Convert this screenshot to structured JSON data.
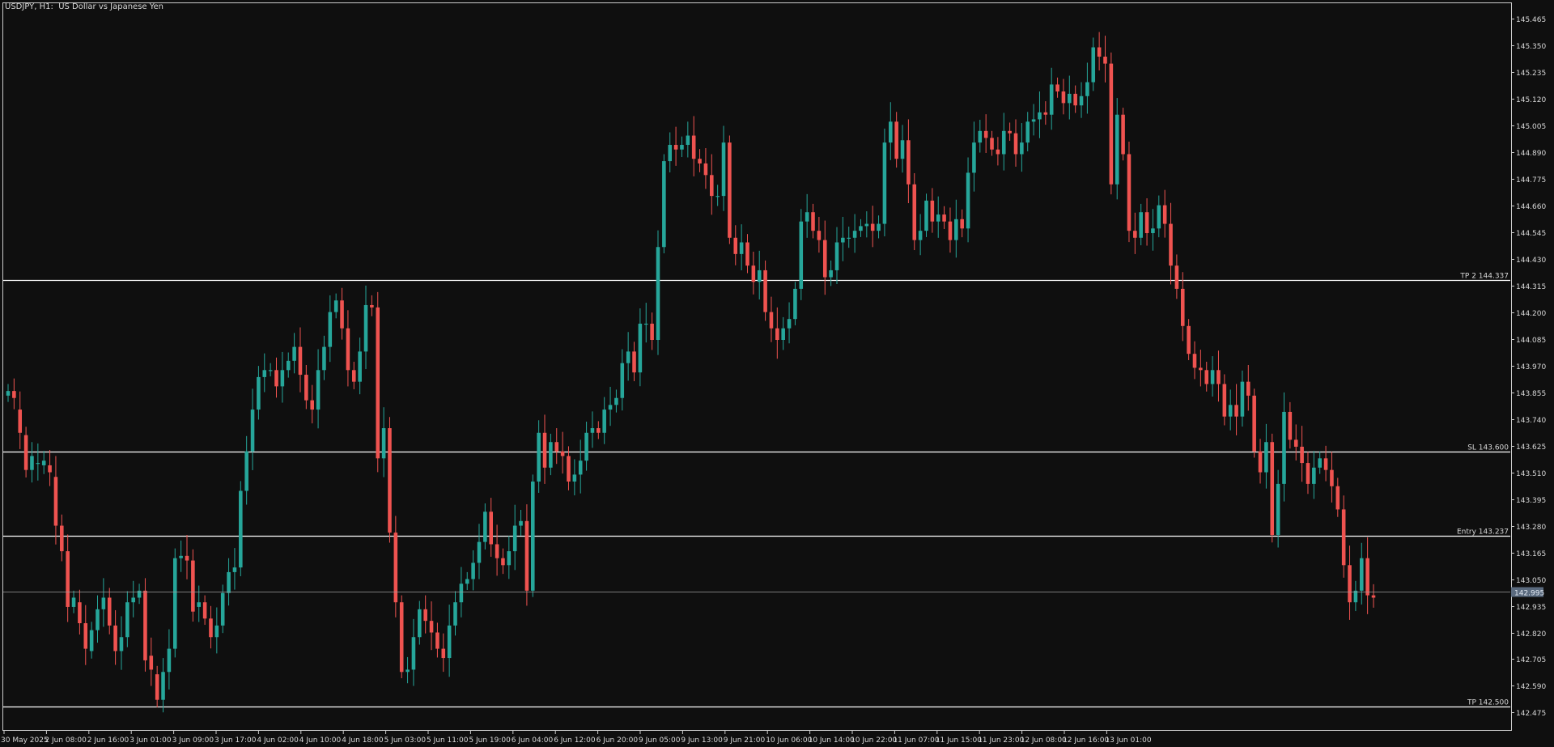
{
  "chart_title": "USDJPY, H1:  US Dollar vs Japanese Yen",
  "colors": {
    "background": "#0f0f0f",
    "frame": "#cccccc",
    "up": "#26a69a",
    "down": "#ef5350",
    "level_line": "#ffffff",
    "bid_line": "#9e9e9e",
    "bid_label_bg": "#5a6a7e",
    "text": "#d8d8d8"
  },
  "chart_data": {
    "type": "candlestick",
    "symbol": "USDJPY",
    "timeframe": "H1",
    "title": "USDJPY, H1:  US Dollar vs Japanese Yen",
    "ylim": [
      142.4,
      145.53
    ],
    "y_tick_labels": [
      "145.465",
      "145.350",
      "145.235",
      "145.120",
      "145.005",
      "144.890",
      "144.775",
      "144.660",
      "144.545",
      "144.430",
      "144.315",
      "144.200",
      "144.085",
      "143.970",
      "143.855",
      "143.740",
      "143.625",
      "143.510",
      "143.395",
      "143.280",
      "143.165",
      "143.050",
      "142.935",
      "142.820",
      "142.705",
      "142.590",
      "142.475"
    ],
    "x_tick_labels": [
      "30 May 2025",
      "2 Jun 08:00",
      "2 Jun 16:00",
      "3 Jun 01:00",
      "3 Jun 09:00",
      "3 Jun 17:00",
      "4 Jun 02:00",
      "4 Jun 10:00",
      "4 Jun 18:00",
      "5 Jun 03:00",
      "5 Jun 11:00",
      "5 Jun 19:00",
      "6 Jun 04:00",
      "6 Jun 12:00",
      "6 Jun 20:00",
      "9 Jun 05:00",
      "9 Jun 13:00",
      "9 Jun 21:00",
      "10 Jun 06:00",
      "10 Jun 14:00",
      "10 Jun 22:00",
      "11 Jun 07:00",
      "11 Jun 15:00",
      "11 Jun 23:00",
      "12 Jun 08:00",
      "12 Jun 16:00",
      "13 Jun 01:00"
    ],
    "levels": [
      {
        "label": "TP 2 144.337",
        "value": 144.337
      },
      {
        "label": "SL 143.600",
        "value": 143.6
      },
      {
        "label": "Entry 143.237",
        "value": 143.237
      },
      {
        "label": "TP 142.500",
        "value": 142.5
      }
    ],
    "bid": {
      "label": "142.995",
      "value": 142.995
    },
    "close": [
      143.86,
      143.83,
      143.68,
      143.52,
      143.58,
      143.55,
      143.56,
      143.51,
      143.28,
      143.17,
      142.93,
      142.97,
      142.86,
      142.75,
      142.83,
      142.92,
      142.97,
      142.85,
      142.74,
      142.8,
      142.95,
      142.97,
      143.0,
      142.7,
      142.66,
      142.53,
      142.65,
      142.75,
      143.14,
      143.15,
      143.13,
      142.91,
      142.95,
      142.88,
      142.8,
      142.85,
      142.99,
      143.08,
      143.1,
      143.43,
      143.6,
      143.78,
      143.92,
      143.95,
      143.95,
      143.88,
      143.95,
      143.99,
      144.05,
      143.93,
      143.82,
      143.78,
      143.95,
      144.05,
      144.2,
      144.25,
      144.13,
      143.95,
      143.9,
      144.03,
      144.23,
      144.22,
      143.57,
      143.7,
      143.25,
      142.95,
      142.65,
      142.66,
      142.8,
      142.92,
      142.87,
      142.82,
      142.75,
      142.71,
      142.85,
      142.95,
      143.03,
      143.05,
      143.12,
      143.21,
      143.34,
      143.2,
      143.14,
      143.11,
      143.17,
      143.28,
      143.3,
      143.0,
      143.47,
      143.68,
      143.53,
      143.64,
      143.6,
      143.58,
      143.47,
      143.5,
      143.56,
      143.68,
      143.7,
      143.68,
      143.78,
      143.8,
      143.83,
      143.98,
      144.03,
      143.94,
      144.15,
      144.15,
      144.08,
      144.48,
      144.85,
      144.92,
      144.9,
      144.92,
      144.96,
      144.86,
      144.84,
      144.79,
      144.7,
      144.7,
      144.93,
      144.52,
      144.45,
      144.5,
      144.4,
      144.33,
      144.38,
      144.2,
      144.13,
      144.08,
      144.13,
      144.17,
      144.3,
      144.59,
      144.63,
      144.55,
      144.51,
      144.35,
      144.38,
      144.5,
      144.52,
      144.52,
      144.55,
      144.57,
      144.58,
      144.55,
      144.58,
      144.93,
      145.02,
      144.86,
      144.94,
      144.75,
      144.51,
      144.55,
      144.68,
      144.59,
      144.62,
      144.59,
      144.51,
      144.6,
      144.56,
      144.8,
      144.93,
      144.98,
      144.95,
      144.9,
      144.88,
      144.98,
      144.97,
      144.88,
      144.93,
      145.02,
      145.03,
      145.06,
      145.05,
      145.18,
      145.15,
      145.1,
      145.14,
      145.09,
      145.13,
      145.19,
      145.34,
      145.3,
      145.27,
      144.75,
      145.05,
      144.88,
      144.55,
      144.52,
      144.63,
      144.54,
      144.56,
      144.66,
      144.58,
      144.4,
      144.3,
      144.14,
      144.02,
      143.96,
      143.95,
      143.89,
      143.95,
      143.89,
      143.75,
      143.8,
      143.75,
      143.9,
      143.84,
      143.6,
      143.51,
      143.64,
      143.24,
      143.46,
      143.77,
      143.65,
      143.62,
      143.55,
      143.46,
      143.53,
      143.57,
      143.52,
      143.45,
      143.35,
      143.11,
      142.95,
      143.0,
      143.14,
      142.98,
      142.97
    ],
    "open": [
      143.84,
      143.86,
      143.78,
      143.67,
      143.52,
      143.55,
      143.54,
      143.54,
      143.49,
      143.28,
      143.17,
      142.93,
      142.95,
      142.86,
      142.74,
      142.83,
      142.92,
      142.97,
      142.85,
      142.74,
      142.8,
      142.95,
      142.97,
      143.0,
      142.72,
      142.64,
      142.53,
      142.65,
      142.75,
      143.14,
      143.15,
      143.13,
      142.93,
      142.95,
      142.88,
      142.8,
      142.85,
      142.99,
      143.08,
      143.1,
      143.43,
      143.6,
      143.78,
      143.92,
      143.95,
      143.95,
      143.88,
      143.95,
      143.99,
      144.05,
      143.93,
      143.82,
      143.78,
      143.95,
      144.05,
      144.2,
      144.25,
      144.13,
      143.95,
      143.9,
      144.03,
      144.23,
      144.22,
      143.57,
      143.7,
      143.25,
      142.95,
      142.65,
      142.66,
      142.8,
      142.92,
      142.87,
      142.82,
      142.75,
      142.71,
      142.85,
      142.95,
      143.03,
      143.05,
      143.12,
      143.21,
      143.34,
      143.2,
      143.14,
      143.11,
      143.17,
      143.28,
      143.3,
      143.0,
      143.47,
      143.68,
      143.53,
      143.64,
      143.6,
      143.58,
      143.47,
      143.5,
      143.56,
      143.68,
      143.7,
      143.68,
      143.78,
      143.8,
      143.83,
      143.98,
      144.03,
      143.94,
      144.15,
      144.15,
      144.08,
      144.48,
      144.85,
      144.92,
      144.9,
      144.92,
      144.96,
      144.86,
      144.84,
      144.79,
      144.7,
      144.7,
      144.93,
      144.52,
      144.45,
      144.5,
      144.4,
      144.33,
      144.38,
      144.2,
      144.13,
      144.08,
      144.13,
      144.17,
      144.3,
      144.59,
      144.63,
      144.55,
      144.51,
      144.35,
      144.38,
      144.5,
      144.52,
      144.52,
      144.55,
      144.57,
      144.58,
      144.55,
      144.58,
      144.93,
      145.02,
      144.86,
      144.94,
      144.75,
      144.51,
      144.55,
      144.68,
      144.59,
      144.62,
      144.59,
      144.51,
      144.6,
      144.56,
      144.8,
      144.93,
      144.98,
      144.95,
      144.9,
      144.88,
      144.98,
      144.97,
      144.88,
      144.93,
      145.02,
      145.03,
      145.06,
      145.05,
      145.18,
      145.15,
      145.1,
      145.14,
      145.09,
      145.13,
      145.19,
      145.34,
      145.3,
      145.27,
      144.75,
      145.05,
      144.88,
      144.55,
      144.52,
      144.63,
      144.54,
      144.56,
      144.66,
      144.58,
      144.4,
      144.3,
      144.14,
      144.02,
      143.96,
      143.95,
      143.89,
      143.95,
      143.89,
      143.75,
      143.8,
      143.75,
      143.9,
      143.84,
      143.6,
      143.51,
      143.64,
      143.24,
      143.46,
      143.77,
      143.65,
      143.62,
      143.55,
      143.46,
      143.53,
      143.57,
      143.52,
      143.45,
      143.35,
      143.11,
      142.95,
      143.0,
      143.14,
      142.98
    ]
  }
}
